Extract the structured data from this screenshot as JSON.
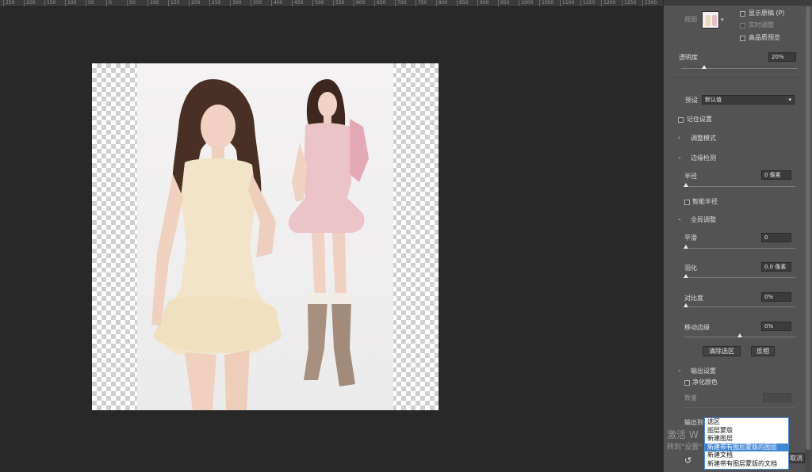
{
  "ruler": {
    "ticks": [
      "250",
      "200",
      "150",
      "100",
      "50",
      "0",
      "50",
      "100",
      "150",
      "200",
      "250",
      "300",
      "350",
      "400",
      "450",
      "500",
      "550",
      "600",
      "650",
      "700",
      "750",
      "800",
      "850",
      "900",
      "950",
      "1000",
      "1050",
      "1100",
      "1150",
      "1200",
      "1250",
      "1300"
    ]
  },
  "panel": {
    "view_label": "视图",
    "show_original": "显示原稿 (P)",
    "realtime_adjust": "实时调整",
    "hq_preview": "高品质预览",
    "opacity_label": "透明度",
    "opacity_value": "20%",
    "preset_label": "预设",
    "preset_value": "默认值",
    "remember_settings": "记住设置",
    "adjust_mode": "调整模式",
    "edge_detection": "边缘检测",
    "radius_label": "半径",
    "radius_value": "0 像素",
    "smart_radius": "智能半径",
    "global_adjust": "全局调整",
    "smooth_label": "平滑",
    "smooth_value": "0",
    "feather_label": "羽化",
    "feather_value": "0.0 像素",
    "contrast_label": "对比度",
    "contrast_value": "0%",
    "shift_edge_label": "移动边缘",
    "shift_edge_value": "0%",
    "clear_selection": "清除选区",
    "invert": "反相",
    "output_settings": "输出设置",
    "decontaminate": "净化颜色",
    "amount_label": "数量",
    "output_to_label": "输出到",
    "cancel_fragment": "取消"
  },
  "dropdown": {
    "options": [
      "选区",
      "图层蒙版",
      "新建图层",
      "新建带有图层蒙版的图层",
      "新建文档",
      "新建带有图层蒙版的文档"
    ],
    "selected_index": 3
  },
  "watermark": {
    "line1": "激活 W",
    "line2": "转到\"设置\""
  }
}
